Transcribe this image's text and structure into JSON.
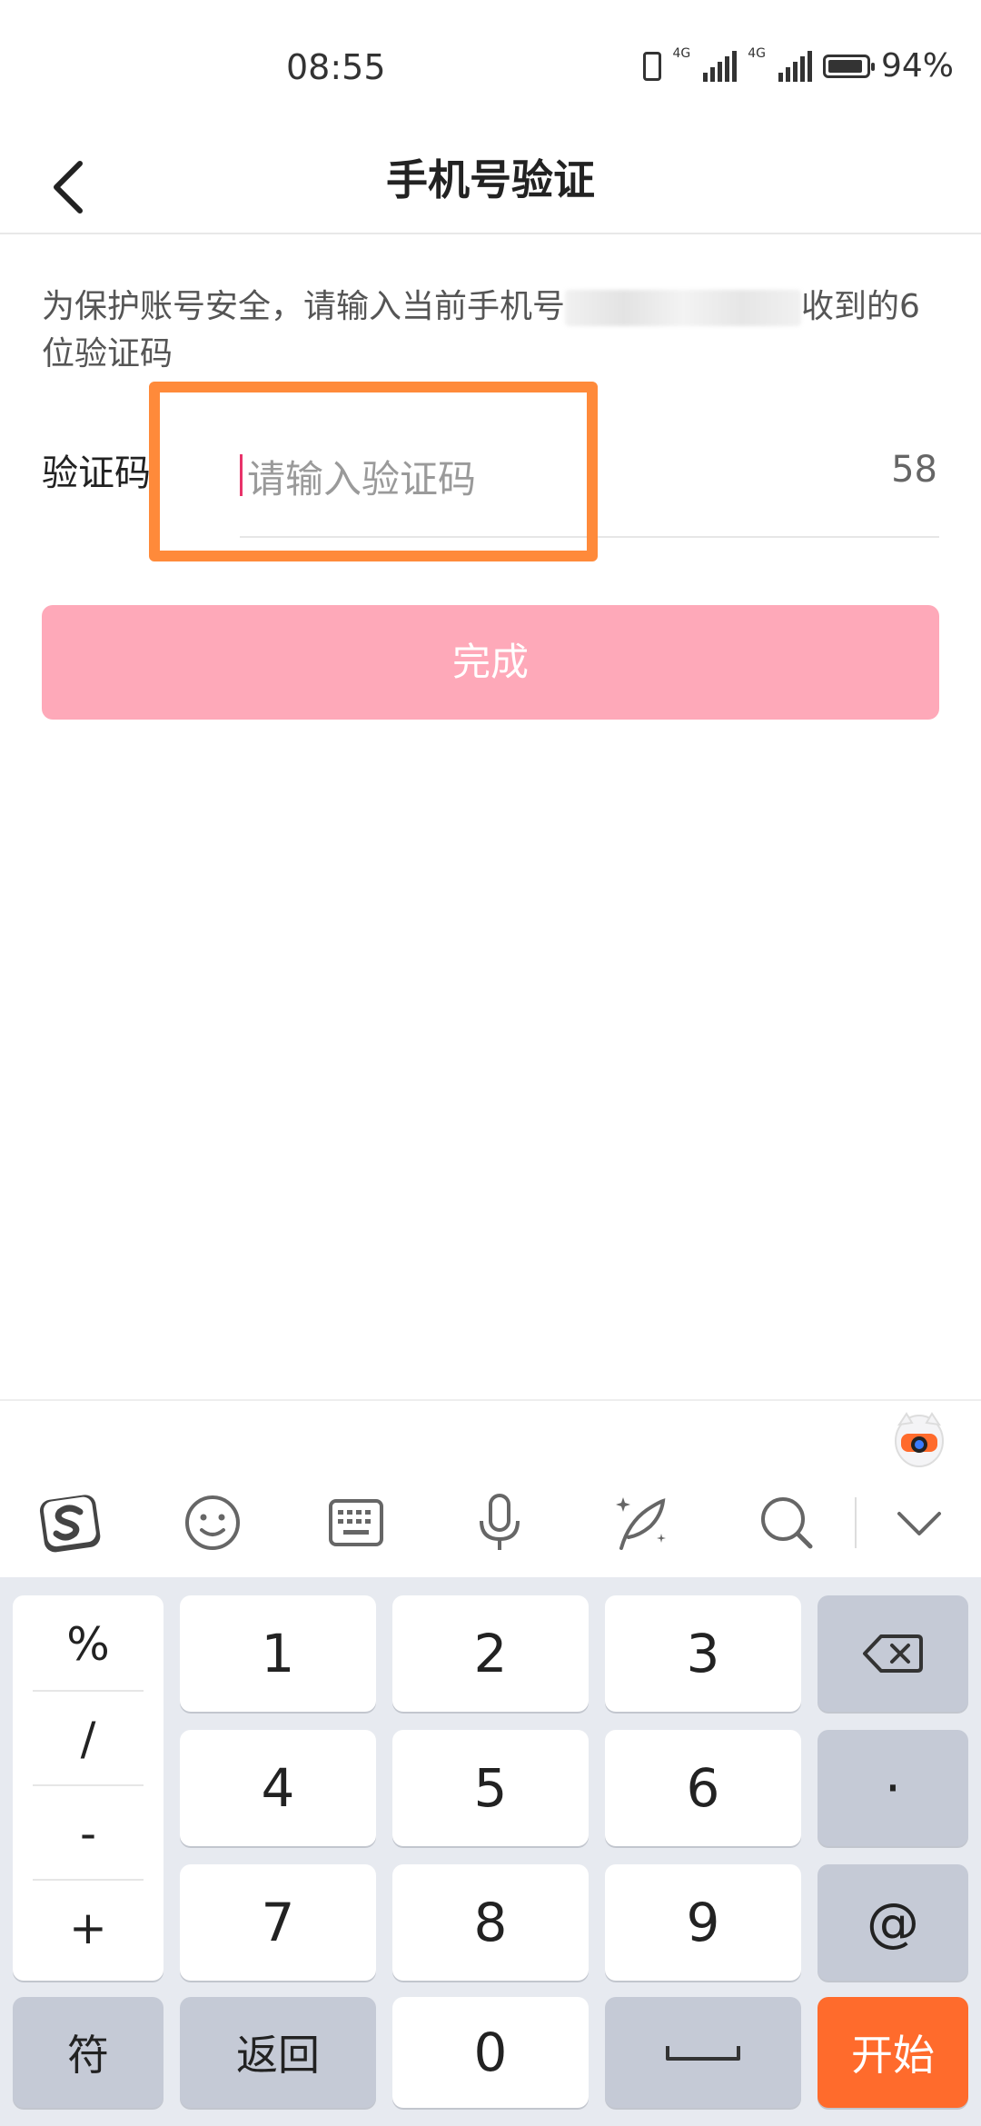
{
  "status": {
    "time": "08:55",
    "network1": "4G",
    "network2": "4G",
    "battery": "94%",
    "battery_level": 0.94
  },
  "header": {
    "title": "手机号验证"
  },
  "description": {
    "prefix": "为保护账号安全，请输入当前手机号",
    "suffix": "收到的6位验证码"
  },
  "form": {
    "label": "验证码",
    "placeholder": "请输入验证码",
    "countdown": "58"
  },
  "submit": {
    "label": "完成"
  },
  "keyboard": {
    "symbols": [
      "%",
      "/",
      "-",
      "+"
    ],
    "digits": [
      "1",
      "2",
      "3",
      "4",
      "5",
      "6",
      "7",
      "8",
      "9",
      "0"
    ],
    "dot": "·",
    "at": "@",
    "symbol_key": "符",
    "back_key": "返回",
    "go_key": "开始"
  },
  "icons": [
    "sogou-logo-icon",
    "emoji-icon",
    "keyboard-icon",
    "microphone-icon",
    "handwriting-icon",
    "search-icon",
    "collapse-icon",
    "backspace-icon",
    "space-icon",
    "back-arrow-icon",
    "assistant-mascot-icon"
  ],
  "colors": {
    "highlight": "#ff8a3a",
    "submit_bg": "#fea9b9",
    "go_key": "#ff6b2c",
    "caret": "#e8336a"
  }
}
